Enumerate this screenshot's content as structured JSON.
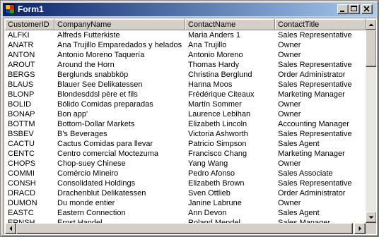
{
  "window": {
    "title": "Form1"
  },
  "grid": {
    "columns": [
      "CustomerID",
      "CompanyName",
      "ContactName",
      "ContactTitle"
    ],
    "rows": [
      [
        "ALFKI",
        "Alfreds Futterkiste",
        "Maria Anders 1",
        "Sales Representative"
      ],
      [
        "ANATR",
        "Ana Trujillo Emparedados y helados",
        "Ana Trujillo",
        "Owner"
      ],
      [
        "ANTON",
        "Antonio Moreno Taquería",
        "Antonio Moreno",
        "Owner"
      ],
      [
        "AROUT",
        "Around the Horn",
        "Thomas Hardy",
        "Sales Representative"
      ],
      [
        "BERGS",
        "Berglunds snabbköp",
        "Christina Berglund",
        "Order Administrator"
      ],
      [
        "BLAUS",
        "Blauer See Delikatessen",
        "Hanna Moos",
        "Sales Representative"
      ],
      [
        "BLONP",
        "Blondesddsl père et fils",
        "Frédérique Citeaux",
        "Marketing Manager"
      ],
      [
        "BOLID",
        "Bólido Comidas preparadas",
        "Martín Sommer",
        "Owner"
      ],
      [
        "BONAP",
        "Bon app'",
        "Laurence Lebihan",
        "Owner"
      ],
      [
        "BOTTM",
        "Bottom-Dollar Markets",
        "Elizabeth Lincoln",
        "Accounting Manager"
      ],
      [
        "BSBEV",
        "B's Beverages",
        "Victoria Ashworth",
        "Sales Representative"
      ],
      [
        "CACTU",
        "Cactus Comidas para llevar",
        "Patricio Simpson",
        "Sales Agent"
      ],
      [
        "CENTC",
        "Centro comercial Moctezuma",
        "Francisco Chang",
        "Marketing Manager"
      ],
      [
        "CHOPS",
        "Chop-suey Chinese",
        "Yang Wang",
        "Owner"
      ],
      [
        "COMMI",
        "Comércio Mineiro",
        "Pedro Afonso",
        "Sales Associate"
      ],
      [
        "CONSH",
        "Consolidated Holdings",
        "Elizabeth Brown",
        "Sales Representative"
      ],
      [
        "DRACD",
        "Drachenblut Delikatessen",
        "Sven Ottlieb",
        "Order Administrator"
      ],
      [
        "DUMON",
        "Du monde entier",
        "Janine Labrune",
        "Owner"
      ],
      [
        "EASTC",
        "Eastern Connection",
        "Ann Devon",
        "Sales Agent"
      ],
      [
        "ERNSH",
        "Ernst Handel",
        "Roland Mendel",
        "Sales Manager"
      ]
    ]
  },
  "vertical_scroll_position": 0,
  "horizontal_scroll_position": 0
}
